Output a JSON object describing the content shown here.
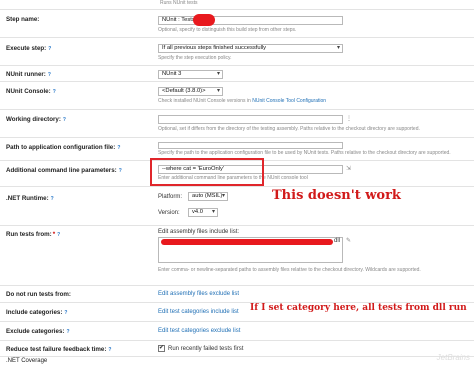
{
  "header": {
    "top_note": "Runs NUnit tests"
  },
  "step_name": {
    "label": "Step name:",
    "value": "NUnit : Tests",
    "note": "Optional, specify to distinguish this build step from other steps."
  },
  "execute_step": {
    "label": "Execute step:",
    "value": "If all previous steps finished successfully",
    "note": "Specify the step execution policy."
  },
  "nunit_runner": {
    "label": "NUnit runner:",
    "value": "NUnit 3"
  },
  "nunit_console": {
    "label": "NUnit Console:",
    "value": "<Default (3.8.0)>",
    "note_prefix": "Check installed NUnit Console versions in",
    "note_link": "NUnit Console Tool Configuration"
  },
  "working_dir": {
    "label": "Working directory:",
    "note": "Optional, set if differs from the directory of the testing assembly. Paths relative to the checkout directory are supported."
  },
  "app_config": {
    "label": "Path to application configuration file:",
    "note": "Specify the path to the application configuration file to be used by NUnit tests. Paths relative to the checkout directory are supported."
  },
  "cmd_params": {
    "label": "Additional command line parameters:",
    "value": "--where cat = 'EuroOnly'",
    "note": "Enter additional command line parameters to the NUnit console tool"
  },
  "net_runtime": {
    "label": ".NET Runtime:",
    "platform_label": "Platform:",
    "platform_value": "auto (MSIL)",
    "version_label": "Version:",
    "version_value": "v4.0"
  },
  "run_tests_from": {
    "label": "Run tests from:",
    "star": "*",
    "list_label": "Edit assembly files include list:",
    "visible_suffix": "dll",
    "note": "Enter comma- or newline-separated paths to assembly files relative to the checkout directory. Wildcards are supported."
  },
  "do_not_run": {
    "label": "Do not run tests from:",
    "link": "Edit assembly files exclude list"
  },
  "include_categories": {
    "label": "Include categories:",
    "link": "Edit test categories include list"
  },
  "exclude_categories": {
    "label": "Exclude categories:",
    "link": "Edit test categories exclude list"
  },
  "reduce_feedback": {
    "label": "Reduce test failure feedback time:",
    "checkbox_label": "Run recently failed tests first",
    "checked": true
  },
  "net_coverage": {
    "label": ".NET Coverage"
  },
  "annotations": {
    "doesnt_work": "This doesn't work",
    "category_note": "If I set category here, all tests from dll run",
    "color": "#d11a1a"
  },
  "help_icon": "?",
  "watermark": "JetBrains"
}
